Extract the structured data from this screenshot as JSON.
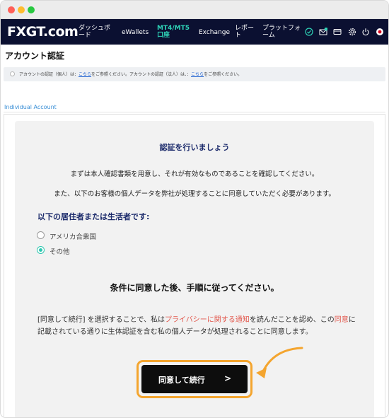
{
  "nav": {
    "logo_a": "FX",
    "logo_b": "GT",
    "logo_c": ".com",
    "items": [
      {
        "label": "ダッシュボ\nード"
      },
      {
        "label": "eWallets"
      },
      {
        "label": "MT4/MT5\n口座"
      },
      {
        "label": "Exchange"
      },
      {
        "label": "レポー\nト"
      },
      {
        "label": "プラットフォ\nーム"
      }
    ]
  },
  "page": {
    "title": "アカウント認証",
    "info_part1": "アカウントの認証（個人）は：",
    "info_link1": "こちら",
    "info_part2": "をご参照ください。アカウントの認証（法人）は、：",
    "info_link2": "こちら",
    "info_part3": "をご参照ください。",
    "tab_label": "Individual Account"
  },
  "panel": {
    "title": "認証を行いましょう",
    "line1": "まずは本人確認書類を用意し、それが有効なものであることを確認してください。",
    "line2": "また、以下のお客様の個人データを弊社が処理することに同意していただく必要があります。",
    "residents_label": "以下の居住者または生活者です:",
    "options": [
      {
        "label": "アメリカ合衆国",
        "checked": false
      },
      {
        "label": "その他",
        "checked": true
      }
    ],
    "subheading": "条件に同意した後、手順に従ってください。",
    "consent_part1": "[同意して続行] を選択することで、私は",
    "consent_link1": "プライバシーに関する通知",
    "consent_part2": "を読んだことを認め、この",
    "consent_link2": "同意",
    "consent_part3": "に記載されている通りに生体認証を含む私の個人データが処理されることに同意します。",
    "button_label": "同意して続行",
    "button_arrow": ">"
  },
  "colors": {
    "navbar": "#0b1031",
    "accent_teal": "#2ed3b7",
    "highlight_orange": "#f4a52f",
    "link_red": "#e2584d",
    "heading_navy": "#1b2a6b"
  }
}
